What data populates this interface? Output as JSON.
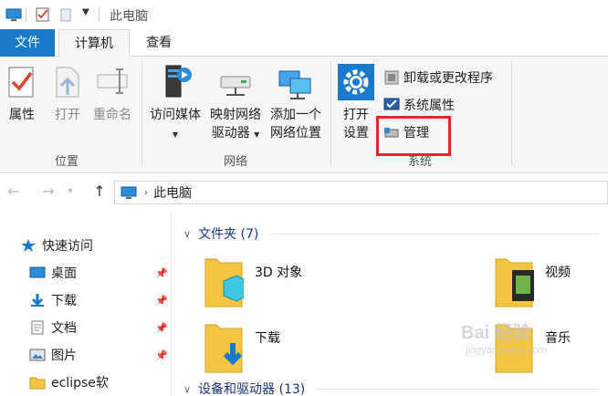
{
  "title_bar": {
    "title": "此电脑"
  },
  "ribbon_tabs": [
    {
      "label": "文件"
    },
    {
      "label": "计算机"
    },
    {
      "label": "查看"
    }
  ],
  "ribbon": {
    "location_group": {
      "label": "位置",
      "properties": "属性",
      "open": "打开",
      "rename": "重命名"
    },
    "network_group": {
      "label": "网络",
      "access_media_1": "访问媒体",
      "map_drive_1": "映射网络",
      "map_drive_2": "驱动器",
      "add_location_1": "添加一个",
      "add_location_2": "网络位置"
    },
    "system_group": {
      "label": "系统",
      "open_settings_1": "打开",
      "open_settings_2": "设置",
      "uninstall": "卸载或更改程序",
      "system_properties": "系统属性",
      "manage": "管理"
    }
  },
  "address_bar": {
    "path": "此电脑"
  },
  "nav_pane": {
    "quick_access": "快速访问",
    "items": [
      {
        "label": "桌面"
      },
      {
        "label": "下载"
      },
      {
        "label": "文档"
      },
      {
        "label": "图片"
      },
      {
        "label": "eclipse软"
      }
    ]
  },
  "content": {
    "folders_header": "文件夹 (7)",
    "folders": [
      {
        "label": "3D 对象"
      },
      {
        "label": "视频"
      },
      {
        "label": "下载"
      },
      {
        "label": "音乐"
      }
    ],
    "devices_header": "设备和驱动器 (13)"
  },
  "watermark": {
    "text": "Bai 经验",
    "sub": "jingyan.baidu.com"
  },
  "colors": {
    "accent": "#1979ca",
    "highlight_box": "#e0262a",
    "folder": "#f4c542"
  }
}
